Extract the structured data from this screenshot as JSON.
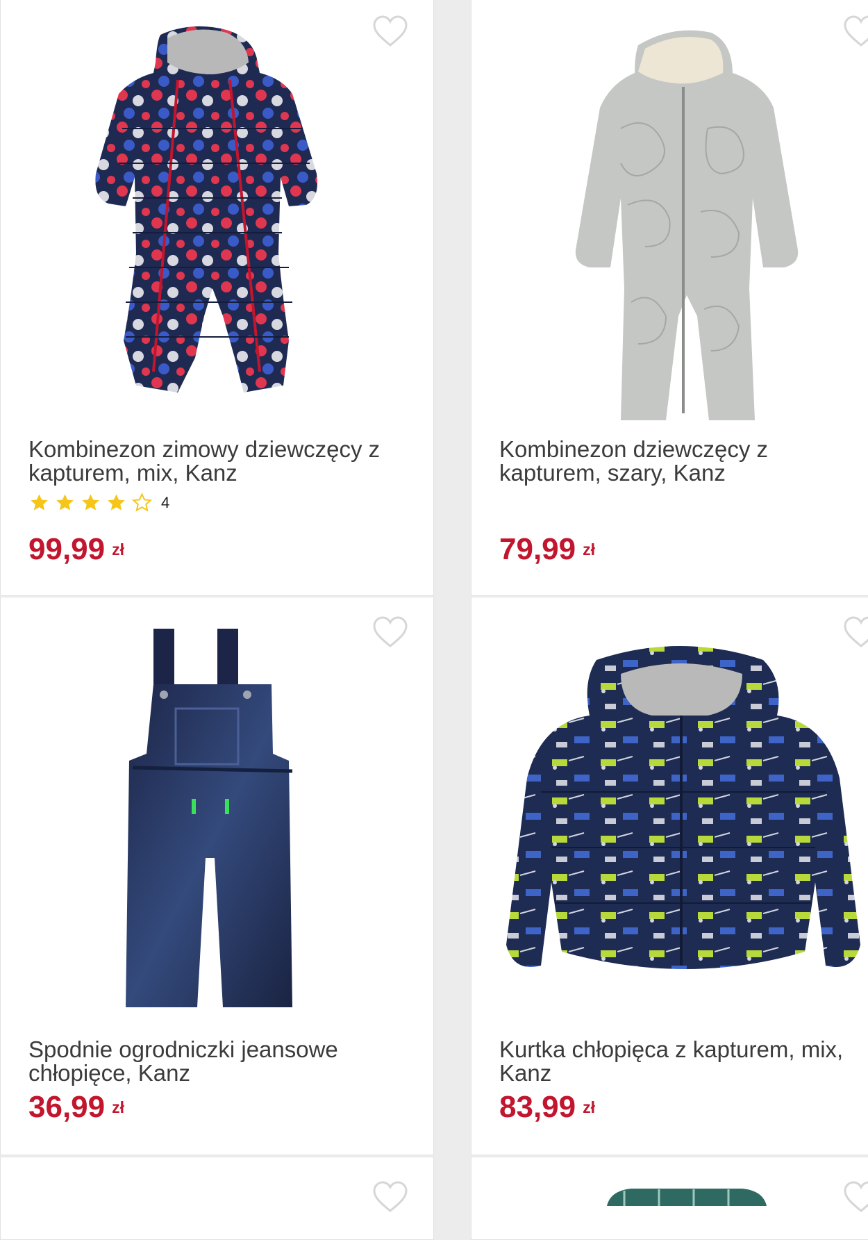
{
  "products": [
    {
      "title": "Kombinezon zimowy dziewczęcy z kapturem, mix, Kanz",
      "price": "99,99",
      "currency": "zł",
      "rating": 4,
      "rating_count": "4",
      "image": "navy polka-dot snowsuit"
    },
    {
      "title": "Kombinezon dziewczęcy z kapturem, szary, Kanz",
      "price": "79,99",
      "currency": "zł",
      "image": "grey quilted snowsuit"
    },
    {
      "title": "Spodnie ogrodniczki jeansowe chłopięce, Kanz",
      "price": "36,99",
      "currency": "zł",
      "image": "denim dungarees"
    },
    {
      "title": "Kurtka chłopięca z kapturem, mix, Kanz",
      "price": "83,99",
      "currency": "zł",
      "image": "navy printed jacket"
    }
  ],
  "icons": {
    "wishlist": "heart-outline-icon",
    "star_full": "star-filled-icon",
    "star_empty": "star-outline-icon"
  },
  "colors": {
    "price": "#c2152e",
    "star": "#f5c518",
    "heart": "#d6d6d6"
  }
}
